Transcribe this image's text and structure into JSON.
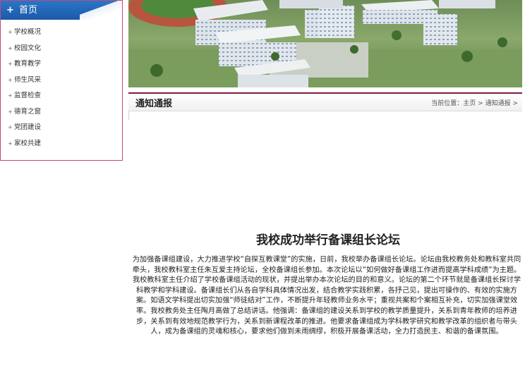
{
  "sidebar": {
    "header": "首页",
    "header_icon": "plus-icon",
    "items": [
      {
        "label": "学校概况"
      },
      {
        "label": "校园文化"
      },
      {
        "label": "教育教学"
      },
      {
        "label": "师生风采"
      },
      {
        "label": "监督检查"
      },
      {
        "label": "德育之窗"
      },
      {
        "label": "党团建设"
      },
      {
        "label": "家校共建"
      }
    ]
  },
  "banner": {
    "image": "school-campus-aerial-photo"
  },
  "section": {
    "title": "通知通报",
    "breadcrumb": {
      "prefix": "当前位置：",
      "home": "主页",
      "sep1": " > ",
      "current": "通知通报",
      "sep2": " >"
    }
  },
  "article": {
    "title": "我校成功举行备课组长论坛",
    "body": "为加强备课组建设，大力推进学校“自探互教课堂”的实施，日前，我校举办备课组长论坛。论坛由我校教务处和教科室共同牵头，我校教科室主任朱互爱主持论坛，全校备课组长参加。本次论坛以“如何做好备课组工作进而提高学科成绩”为主题。我校教科室主任介绍了学校备课组活动的现状，并提出举办本次论坛的目的和意义。论坛的第二个环节就是备课组长探讨学科教学和学科建设。备课组长们从各自学科具体情况出发，结合教学实践积累，各抒己见，提出可操作的、有效的实施方案。如语文学科提出切实加强“师徒结对”工作，不断提升年轻教师业务水平；重视共案和个案相互补充，切实加强课堂效率。我校教务处主任陶月高做了总结讲话。他强调：备课组的建设关系到学校的教学质量提升，关系到青年教师的培养进步，关系到有效地规范教学行为，关系到新课程改革的推进。他要求备课组成为学科教学研究和教学改革的组织者与带头人，成为备课组的灵魂和核心，要求他们做到未雨绸缪，积极开展备课活动，全力打造民主、和谐的备课氛围。"
  },
  "colors": {
    "sidebar_border": "#c8467a",
    "sidebar_header": "#1a5aa8",
    "crumb_accent": "#7a1d3c"
  }
}
